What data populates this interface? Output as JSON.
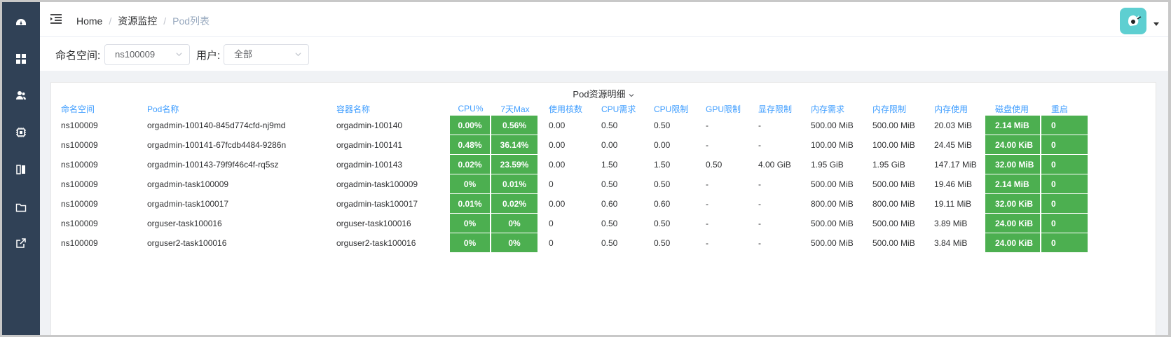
{
  "nav": {
    "sidebar_icons": [
      "dashboard-icon",
      "grid-icon",
      "users-icon",
      "chip-icon",
      "split-view-icon",
      "folder-icon",
      "external-link-icon"
    ],
    "breadcrumb": {
      "home": "Home",
      "section": "资源监控",
      "current": "Pod列表"
    }
  },
  "filters": {
    "namespace_label": "命名空间:",
    "namespace_value": "ns100009",
    "user_label": "用户:",
    "user_value": "全部"
  },
  "card": {
    "title": "Pod资源明细"
  },
  "table": {
    "headers": [
      "命名空间",
      "Pod名称",
      "容器名称",
      "CPU%",
      "7天Max",
      "使用核数",
      "CPU需求",
      "CPU限制",
      "GPU限制",
      "显存限制",
      "内存需求",
      "内存限制",
      "内存使用",
      "磁盘使用",
      "重启"
    ],
    "rows": [
      [
        "ns100009",
        "orgadmin-100140-845d774cfd-nj9md",
        "orgadmin-100140",
        "0.00%",
        "0.56%",
        "0.00",
        "0.50",
        "0.50",
        "-",
        "-",
        "500.00 MiB",
        "500.00 MiB",
        "20.03 MiB",
        "2.14 MiB",
        "0"
      ],
      [
        "ns100009",
        "orgadmin-100141-67fcdb4484-9286n",
        "orgadmin-100141",
        "0.48%",
        "36.14%",
        "0.00",
        "0.00",
        "0.00",
        "-",
        "-",
        "100.00 MiB",
        "100.00 MiB",
        "24.45 MiB",
        "24.00 KiB",
        "0"
      ],
      [
        "ns100009",
        "orgadmin-100143-79f9f46c4f-rq5sz",
        "orgadmin-100143",
        "0.02%",
        "23.59%",
        "0.00",
        "1.50",
        "1.50",
        "0.50",
        "4.00 GiB",
        "1.95 GiB",
        "1.95 GiB",
        "147.17 MiB",
        "32.00 MiB",
        "0"
      ],
      [
        "ns100009",
        "orgadmin-task100009",
        "orgadmin-task100009",
        "0%",
        "0.01%",
        "0",
        "0.50",
        "0.50",
        "-",
        "-",
        "500.00 MiB",
        "500.00 MiB",
        "19.46 MiB",
        "2.14 MiB",
        "0"
      ],
      [
        "ns100009",
        "orgadmin-task100017",
        "orgadmin-task100017",
        "0.01%",
        "0.02%",
        "0.00",
        "0.60",
        "0.60",
        "-",
        "-",
        "800.00 MiB",
        "800.00 MiB",
        "19.11 MiB",
        "32.00 KiB",
        "0"
      ],
      [
        "ns100009",
        "orguser-task100016",
        "orguser-task100016",
        "0%",
        "0%",
        "0",
        "0.50",
        "0.50",
        "-",
        "-",
        "500.00 MiB",
        "500.00 MiB",
        "3.89 MiB",
        "24.00 KiB",
        "0"
      ],
      [
        "ns100009",
        "orguser2-task100016",
        "orguser2-task100016",
        "0%",
        "0%",
        "0",
        "0.50",
        "0.50",
        "-",
        "-",
        "500.00 MiB",
        "500.00 MiB",
        "3.84 MiB",
        "24.00 KiB",
        "0"
      ]
    ]
  },
  "colors": {
    "sidebar": "#304156",
    "header_text": "#409eff",
    "status_green": "#4caf50",
    "avatar": "#5ecfd1"
  }
}
